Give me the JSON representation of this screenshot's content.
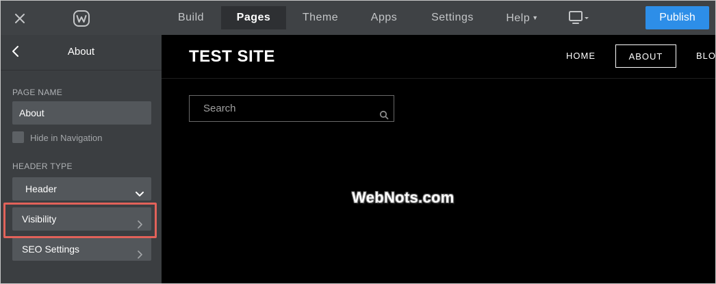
{
  "topbar": {
    "tabs": [
      {
        "label": "Build"
      },
      {
        "label": "Pages"
      },
      {
        "label": "Theme"
      },
      {
        "label": "Apps"
      },
      {
        "label": "Settings"
      },
      {
        "label": "Help"
      }
    ],
    "active_tab": "Pages",
    "publish_label": "Publish",
    "icons": {
      "close": "close-icon",
      "logo": "weebly-logo-icon",
      "device": "desktop-icon"
    },
    "colors": {
      "bar": "#3f4245",
      "publish": "#2d8ee8"
    }
  },
  "sidebar": {
    "title": "About",
    "page_name_label": "PAGE NAME",
    "page_name_value": "About",
    "hide_nav_label": "Hide in Navigation",
    "hide_nav_checked": false,
    "header_type_label": "HEADER TYPE",
    "header_type_value": "Header",
    "visibility_label": "Visibility",
    "seo_label": "SEO Settings",
    "highlight_color": "#e2625a"
  },
  "preview": {
    "site_title": "TEST SITE",
    "nav": [
      {
        "label": "HOME"
      },
      {
        "label": "ABOUT"
      },
      {
        "label": "BLO"
      }
    ],
    "active_nav": "ABOUT",
    "search_placeholder": "Search"
  },
  "watermark": "WebNots.com"
}
